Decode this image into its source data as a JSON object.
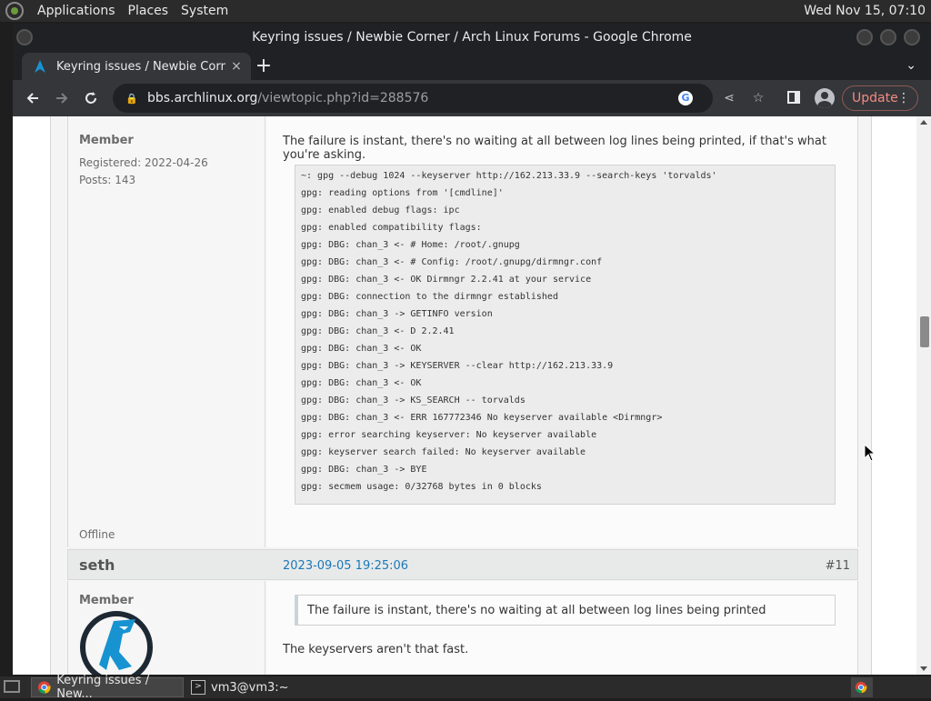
{
  "top_panel": {
    "menus": [
      "Applications",
      "Places",
      "System"
    ],
    "clock": "Wed Nov 15, 07:10"
  },
  "window": {
    "title": "Keyring issues / Newbie Corner / Arch Linux Forums - Google Chrome"
  },
  "tab": {
    "title": "Keyring issues / Newbie Corner",
    "close": "×"
  },
  "toolbar": {
    "url_host": "bbs.archlinux.org",
    "url_path": "/viewtopic.php?id=288576",
    "update_label": "Update"
  },
  "post1": {
    "title": "Member",
    "registered": "Registered: 2022-04-26",
    "posts": "Posts: 143",
    "status": "Offline",
    "text": "The failure is instant, there's no waiting at all between log lines being printed, if that's what you're asking.",
    "code_lines": [
      "~: gpg --debug 1024 --keyserver http://162.213.33.9 --search-keys 'torvalds'",
      "gpg: reading options from '[cmdline]'",
      "gpg: enabled debug flags: ipc",
      "gpg: enabled compatibility flags:",
      "gpg: DBG: chan_3 <- # Home: /root/.gnupg",
      "gpg: DBG: chan_3 <- # Config: /root/.gnupg/dirmngr.conf",
      "gpg: DBG: chan_3 <- OK Dirmngr 2.2.41 at your service",
      "gpg: DBG: connection to the dirmngr established",
      "gpg: DBG: chan_3 -> GETINFO version",
      "gpg: DBG: chan_3 <- D 2.2.41",
      "gpg: DBG: chan_3 <- OK",
      "gpg: DBG: chan_3 -> KEYSERVER --clear http://162.213.33.9",
      "gpg: DBG: chan_3 <- OK",
      "gpg: DBG: chan_3 -> KS_SEARCH -- torvalds",
      "gpg: DBG: chan_3 <- ERR 167772346 No keyserver available <Dirmngr>",
      "gpg: error searching keyserver: No keyserver available",
      "gpg: keyserver search failed: No keyserver available",
      "gpg: DBG: chan_3 -> BYE",
      "gpg: secmem usage: 0/32768 bytes in 0 blocks"
    ]
  },
  "post2": {
    "author": "seth",
    "date": "2023-09-05 19:25:06",
    "number": "#11",
    "title": "Member",
    "quote": "The failure is instant, there's no waiting at all between log lines being printed",
    "text": "The keyservers aren't that fast."
  },
  "taskbar": {
    "items": [
      "Keyring issues / New...",
      "vm3@vm3:~"
    ]
  },
  "colors": {
    "link": "#1a78b8",
    "update_text": "#f28b82",
    "arch_blue": "#1793d1"
  }
}
